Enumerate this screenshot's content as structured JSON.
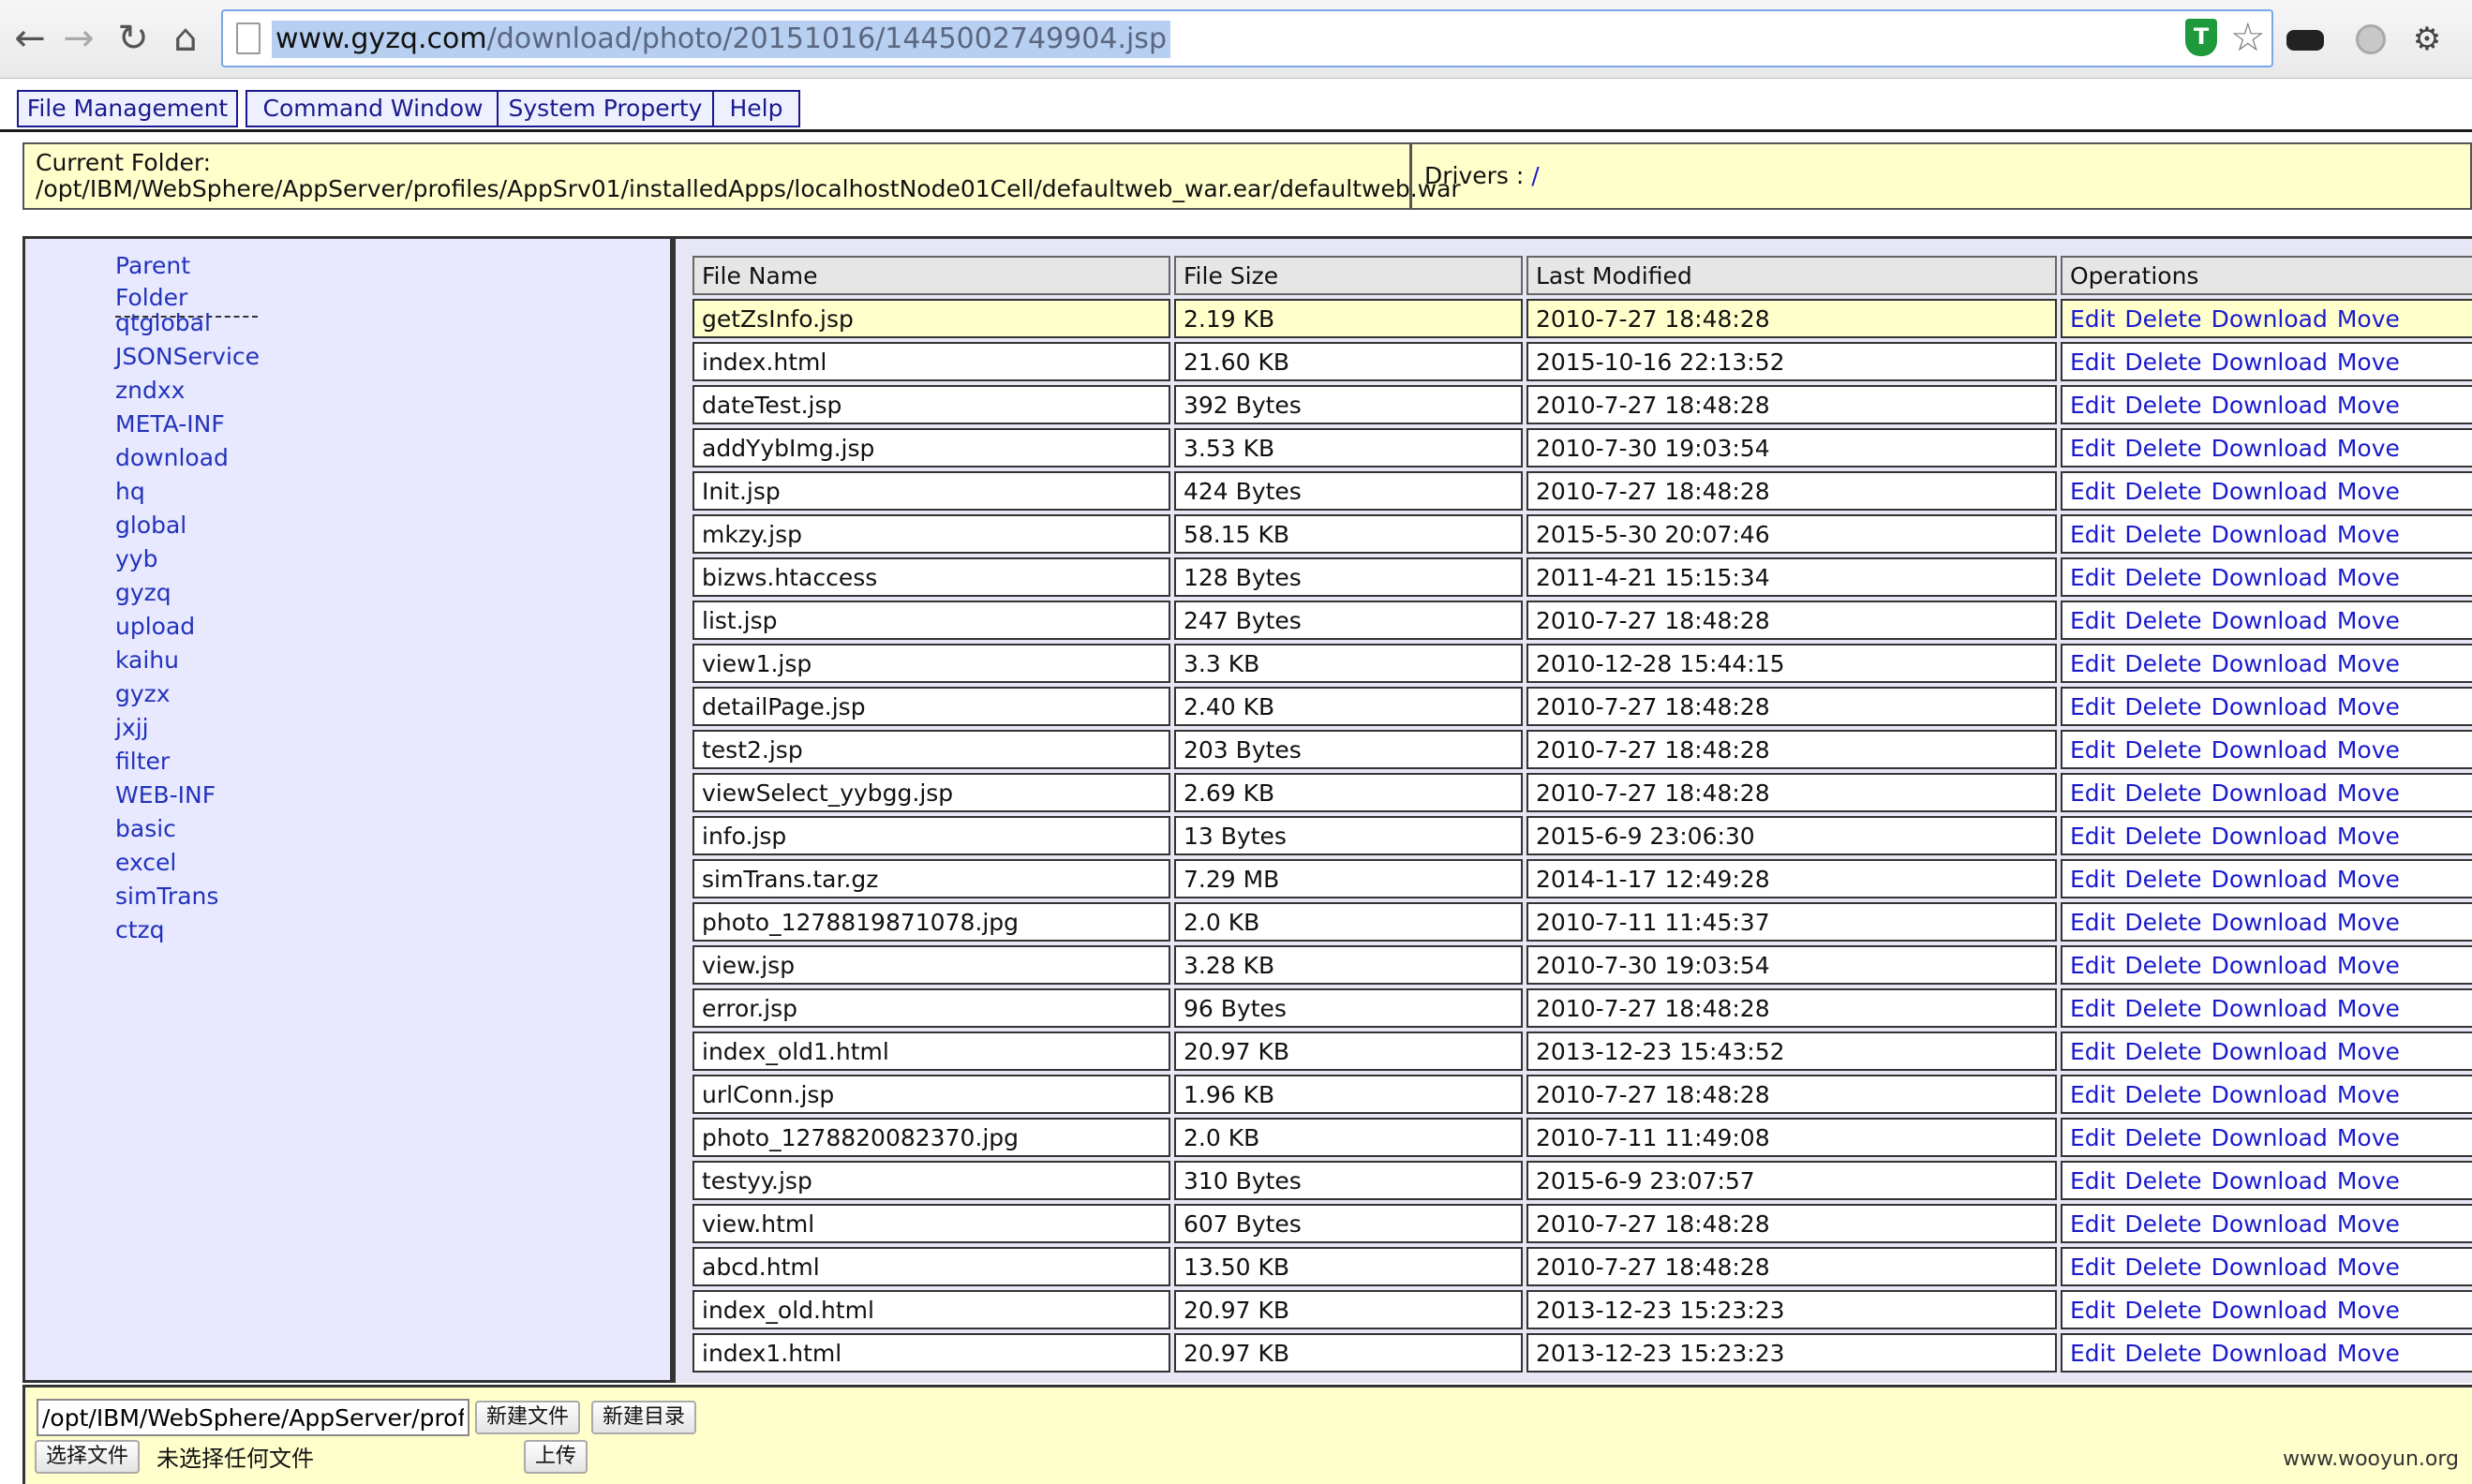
{
  "browser": {
    "url_host": "www.gyzq.com",
    "url_path": "/download/photo/20151016/1445002749904.jsp"
  },
  "menu": [
    "File Management",
    "Command Window",
    "System Property",
    "Help"
  ],
  "folder": {
    "current_label": "Current Folder:",
    "current_path": "/opt/IBM/WebSphere/AppServer/profiles/AppSrv01/installedApps/localhostNode01Cell/defaultweb_war.ear/defaultweb.war",
    "drivers_label": "Drivers : ",
    "drivers_link": "/"
  },
  "sidebar": {
    "parent_label": "Parent Folder",
    "folders": [
      "qtglobal",
      "JSONService",
      "zndxx",
      "META-INF",
      "download",
      "hq",
      "global",
      "yyb",
      "gyzq",
      "upload",
      "kaihu",
      "gyzx",
      "jxjj",
      "filter",
      "WEB-INF",
      "basic",
      "excel",
      "simTrans",
      "ctzq"
    ]
  },
  "table": {
    "headers": [
      "File Name",
      "File Size",
      "Last Modified",
      "Operations"
    ],
    "operations": [
      "Edit",
      "Delete",
      "Download",
      "Move"
    ],
    "rows": [
      [
        "getZsInfo.jsp",
        "2.19 KB",
        "2010-7-27 18:48:28"
      ],
      [
        "index.html",
        "21.60 KB",
        "2015-10-16 22:13:52"
      ],
      [
        "dateTest.jsp",
        "392 Bytes",
        "2010-7-27 18:48:28"
      ],
      [
        "addYybImg.jsp",
        "3.53 KB",
        "2010-7-30 19:03:54"
      ],
      [
        "Init.jsp",
        "424 Bytes",
        "2010-7-27 18:48:28"
      ],
      [
        "mkzy.jsp",
        "58.15 KB",
        "2015-5-30 20:07:46"
      ],
      [
        "bizws.htaccess",
        "128 Bytes",
        "2011-4-21 15:15:34"
      ],
      [
        "list.jsp",
        "247 Bytes",
        "2010-7-27 18:48:28"
      ],
      [
        "view1.jsp",
        "3.3 KB",
        "2010-12-28 15:44:15"
      ],
      [
        "detailPage.jsp",
        "2.40 KB",
        "2010-7-27 18:48:28"
      ],
      [
        "test2.jsp",
        "203 Bytes",
        "2010-7-27 18:48:28"
      ],
      [
        "viewSelect_yybgg.jsp",
        "2.69 KB",
        "2010-7-27 18:48:28"
      ],
      [
        "info.jsp",
        "13 Bytes",
        "2015-6-9 23:06:30"
      ],
      [
        "simTrans.tar.gz",
        "7.29 MB",
        "2014-1-17 12:49:28"
      ],
      [
        "photo_1278819871078.jpg",
        "2.0 KB",
        "2010-7-11 11:45:37"
      ],
      [
        "view.jsp",
        "3.28 KB",
        "2010-7-30 19:03:54"
      ],
      [
        "error.jsp",
        "96 Bytes",
        "2010-7-27 18:48:28"
      ],
      [
        "index_old1.html",
        "20.97 KB",
        "2013-12-23 15:43:52"
      ],
      [
        "urlConn.jsp",
        "1.96 KB",
        "2010-7-27 18:48:28"
      ],
      [
        "photo_1278820082370.jpg",
        "2.0 KB",
        "2010-7-11 11:49:08"
      ],
      [
        "testyy.jsp",
        "310 Bytes",
        "2015-6-9 23:07:57"
      ],
      [
        "view.html",
        "607 Bytes",
        "2010-7-27 18:48:28"
      ],
      [
        "abcd.html",
        "13.50 KB",
        "2010-7-27 18:48:28"
      ],
      [
        "index_old.html",
        "20.97 KB",
        "2013-12-23 15:23:23"
      ],
      [
        "index1.html",
        "20.97 KB",
        "2013-12-23 15:23:23"
      ]
    ]
  },
  "bottom": {
    "path_value": "/opt/IBM/WebSphere/AppServer/profi",
    "new_file": "新建文件",
    "new_folder": "新建目录",
    "choose_file": "选择文件",
    "no_file": "未选择任何文件",
    "upload": "上传"
  },
  "watermark": "www.wooyun.org",
  "icons": {
    "back": "←",
    "forward": "→",
    "reload": "↻",
    "home": "⌂",
    "star": "☆",
    "wrench": "⚙",
    "shield": "T"
  },
  "colors": {
    "link": "#1a1acc",
    "highlight_row": "#ffffcc",
    "sidebar_bg": "#e8e8ff",
    "menu_border": "#1a1a8c"
  }
}
